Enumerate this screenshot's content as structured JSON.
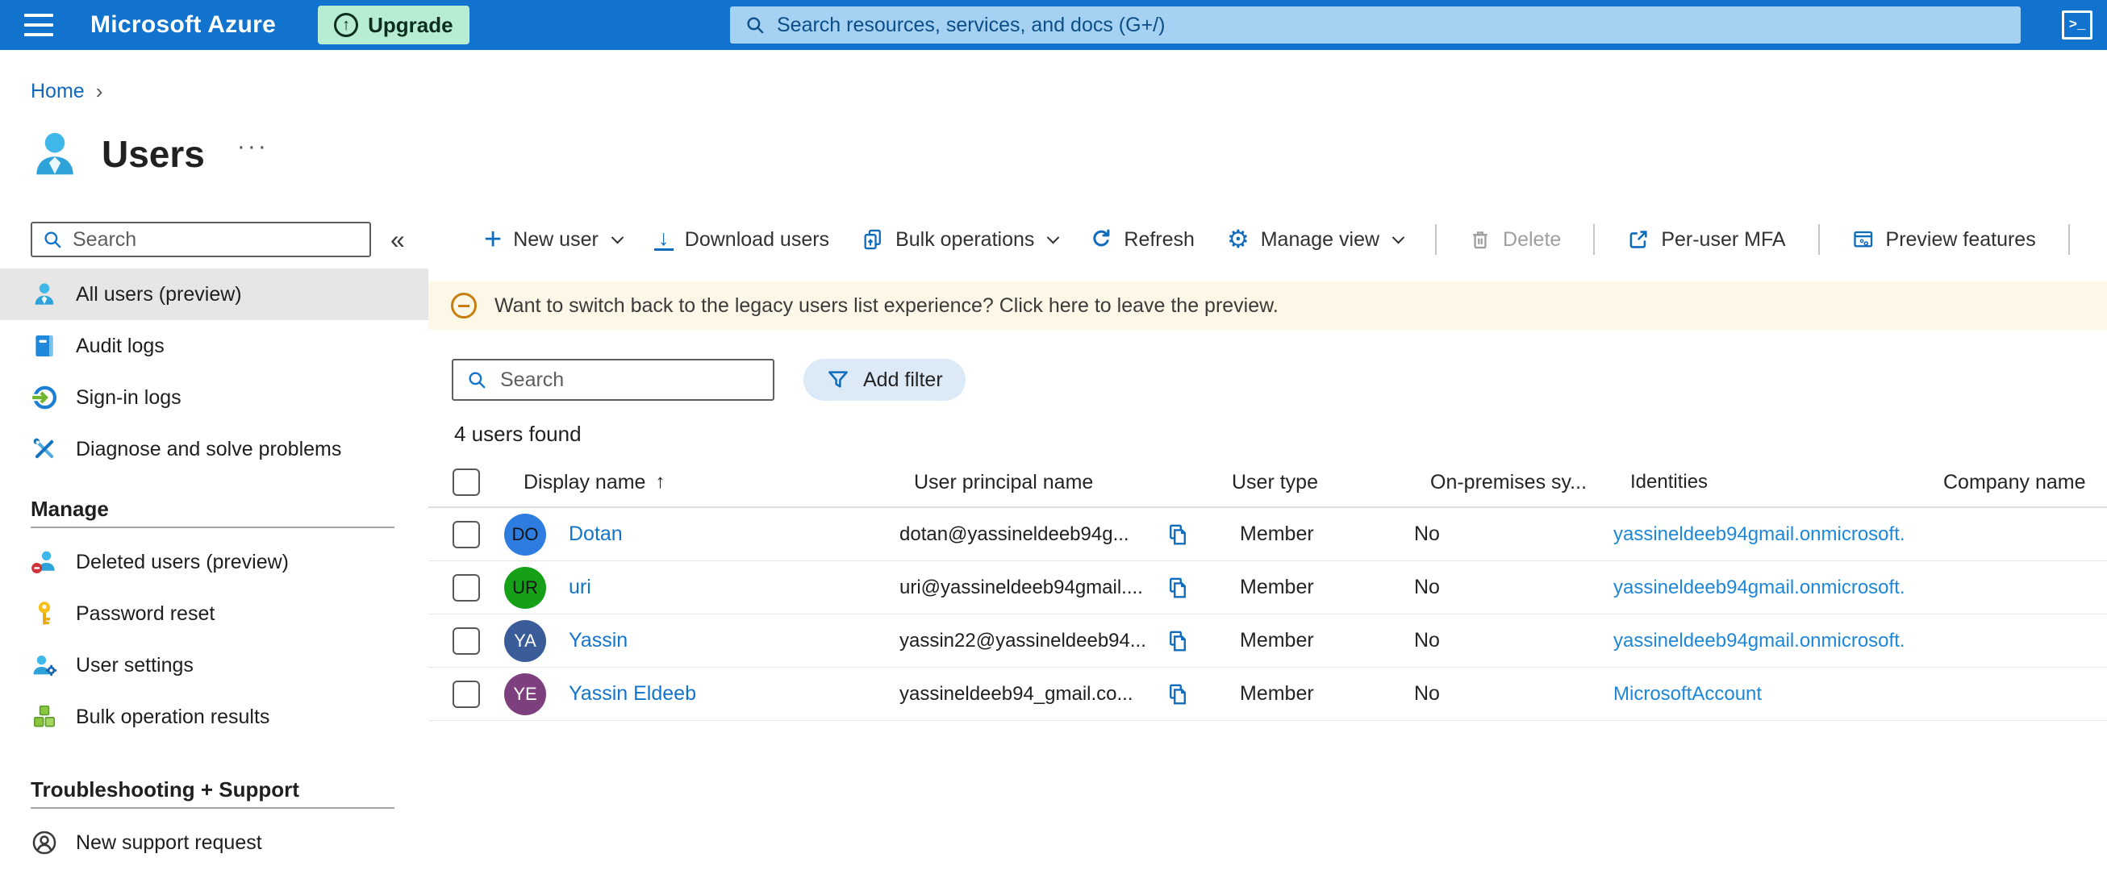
{
  "icons": {
    "upgrade_arrow": "↑",
    "breadcrumb_chevron": "›",
    "more_options": "···",
    "collapse": "«",
    "gear": "⚙",
    "cloud_shell": ">_",
    "sort_ascending": "↑",
    "plus": "+",
    "download_arrow": "↓"
  },
  "topbar": {
    "brand": "Microsoft Azure",
    "upgrade_label": "Upgrade",
    "search_placeholder": "Search resources, services, and docs (G+/)"
  },
  "breadcrumb": {
    "home": "Home"
  },
  "page": {
    "title": "Users"
  },
  "sidebar": {
    "search_placeholder": "Search",
    "items": [
      {
        "label": "All users (preview)"
      },
      {
        "label": "Audit logs"
      },
      {
        "label": "Sign-in logs"
      },
      {
        "label": "Diagnose and solve problems"
      }
    ],
    "manage": {
      "title": "Manage",
      "items": [
        {
          "label": "Deleted users (preview)"
        },
        {
          "label": "Password reset"
        },
        {
          "label": "User settings"
        },
        {
          "label": "Bulk operation results"
        }
      ]
    },
    "support": {
      "title": "Troubleshooting + Support",
      "items": [
        {
          "label": "New support request"
        }
      ]
    }
  },
  "toolbar": {
    "new_user": "New user",
    "download_users": "Download users",
    "bulk_operations": "Bulk operations",
    "refresh": "Refresh",
    "manage_view": "Manage view",
    "delete": "Delete",
    "per_user_mfa": "Per-user MFA",
    "preview_features": "Preview features"
  },
  "banner": {
    "text": "Want to switch back to the legacy users list experience? Click here to leave the preview."
  },
  "filters": {
    "search_placeholder": "Search",
    "add_filter_label": "Add filter"
  },
  "results_count": "4 users found",
  "table": {
    "columns": [
      "Display name",
      "User principal name",
      "User type",
      "On-premises sy...",
      "Identities",
      "Company name"
    ],
    "rows": [
      {
        "initials": "DO",
        "avatar_bg": "#2E7CDF",
        "avatar_fg": "#121212",
        "display_name": "Dotan",
        "upn": "dotan@yassineldeeb94g...",
        "user_type": "Member",
        "on_premises_sync": "No",
        "identities": "yassineldeeb94gmail.onmicrosoft.",
        "company_name": ""
      },
      {
        "initials": "UR",
        "avatar_bg": "#16A018",
        "avatar_fg": "#121212",
        "display_name": "uri",
        "upn": "uri@yassineldeeb94gmail....",
        "user_type": "Member",
        "on_premises_sync": "No",
        "identities": "yassineldeeb94gmail.onmicrosoft.",
        "company_name": ""
      },
      {
        "initials": "YA",
        "avatar_bg": "#3A5C99",
        "avatar_fg": "#FFFFFF",
        "display_name": "Yassin",
        "upn": "yassin22@yassineldeeb94...",
        "user_type": "Member",
        "on_premises_sync": "No",
        "identities": "yassineldeeb94gmail.onmicrosoft.",
        "company_name": ""
      },
      {
        "initials": "YE",
        "avatar_bg": "#7D3F7D",
        "avatar_fg": "#FFFFFF",
        "display_name": "Yassin Eldeeb",
        "upn": "yassineldeeb94_gmail.co...",
        "user_type": "Member",
        "on_premises_sync": "No",
        "identities": "MicrosoftAccount",
        "company_name": ""
      }
    ]
  },
  "colors": {
    "topbar_bg": "#1173CE",
    "upgrade_bg": "#B7EDD3",
    "banner_bg": "#FDF7E7",
    "accent_blue": "#0F6CBD",
    "link_blue": "#1374CC",
    "identities_link_blue": "#1E87D7",
    "banner_icon_orange": "#C87E0E",
    "sidebar_selected_bg": "#E6E6E6"
  }
}
